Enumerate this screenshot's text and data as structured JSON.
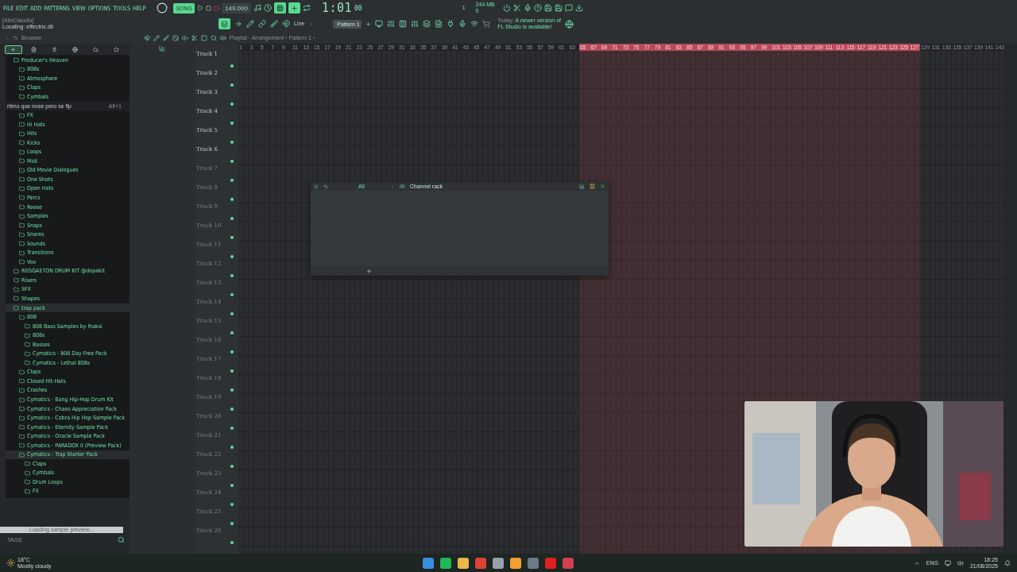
{
  "menu": [
    "FILE",
    "EDIT",
    "ADD",
    "PATTERNS",
    "VIEW",
    "OPTIONS",
    "TOOLS",
    "HELP"
  ],
  "transport": {
    "mode": "SONG",
    "tempo": "149.000",
    "time_main": "1:01",
    "time_sub": "00"
  },
  "monitor": {
    "voices": "1",
    "memory": "244 MB",
    "cpu": "0"
  },
  "hint": {
    "title": "[AlinClaudiu]",
    "text": "Locating: effectrix.dll"
  },
  "snap": "Line",
  "pattern": "Pattern 1",
  "news": {
    "date": "Today:",
    "line1": "A newer version of",
    "line2": "FL Studio is available!"
  },
  "browser": {
    "title": "Browser",
    "tabs": [
      {
        "selected": true
      },
      {
        "selected": false
      },
      {
        "selected": false
      },
      {
        "selected": false
      },
      {
        "selected": false
      },
      {
        "selected": false
      }
    ],
    "tree": [
      {
        "label": "Producer's Heaven",
        "selected": false,
        "children": [
          {
            "label": "808s",
            "selected": false
          },
          {
            "label": "Atmosphere",
            "selected": false
          },
          {
            "label": "Claps",
            "selected": false
          },
          {
            "label": "Cymbals",
            "selected": false
          },
          {
            "kind": "tooltip",
            "label": "ritmo que nose pero se flp",
            "shortcut": "Alt+1"
          },
          {
            "label": "FX",
            "selected": false
          },
          {
            "label": "Hi Hats",
            "selected": false
          },
          {
            "label": "Hits",
            "selected": false
          },
          {
            "label": "Kicks",
            "selected": false
          },
          {
            "label": "Loops",
            "selected": false
          },
          {
            "label": "Midi",
            "selected": false
          },
          {
            "label": "Old Movie Dialogues",
            "selected": false
          },
          {
            "label": "One Shots",
            "selected": false
          },
          {
            "label": "Open Hats",
            "selected": false
          },
          {
            "label": "Percs",
            "selected": false
          },
          {
            "label": "Reese",
            "selected": false
          },
          {
            "label": "Samples",
            "selected": false
          },
          {
            "label": "Snaps",
            "selected": false
          },
          {
            "label": "Snares",
            "selected": false
          },
          {
            "label": "Sounds",
            "selected": false
          },
          {
            "label": "Transitions",
            "selected": false
          },
          {
            "label": "Vox",
            "selected": false
          }
        ]
      },
      {
        "label": "REGGAETON DRUM KIT @dopekit",
        "selected": false
      },
      {
        "label": "Risers",
        "selected": false
      },
      {
        "label": "SFX",
        "selected": false
      },
      {
        "label": "Shapes",
        "selected": false
      },
      {
        "label": "trap pack",
        "selected": true,
        "children": [
          {
            "label": "808",
            "selected": false,
            "children": [
              {
                "label": "808 Bass Samples by Ihaksi",
                "selected": false
              },
              {
                "label": "808s",
                "selected": false
              },
              {
                "label": "Basses",
                "selected": false
              },
              {
                "label": "Cymatics - 808 Day Free Pack",
                "selected": false
              },
              {
                "label": "Cymatics - Lethal 808s",
                "selected": false
              }
            ]
          },
          {
            "label": "Claps",
            "selected": false
          },
          {
            "label": "Closed Hit-Hats",
            "selected": false
          },
          {
            "label": "Crashes",
            "selected": false
          },
          {
            "label": "Cymatics - Bang Hip-Hop Drum Kit",
            "selected": false
          },
          {
            "label": "Cymatics - Chaos Appreciation Pack",
            "selected": false
          },
          {
            "label": "Cymatics - Cobra Hip Hop Sample Pack",
            "selected": false
          },
          {
            "label": "Cymatics - Eternity Sample Pack",
            "selected": false
          },
          {
            "label": "Cymatics - Oracle Sample Pack",
            "selected": false
          },
          {
            "label": "Cymatics - PARADOX II (Preview Pack)",
            "selected": false
          },
          {
            "label": "Cymatics - Trap Starter Pack",
            "selected": true,
            "children": [
              {
                "label": "Claps",
                "selected": false
              },
              {
                "label": "Cymbals",
                "selected": false
              },
              {
                "label": "Drum Loops",
                "selected": false
              },
              {
                "label": "FX",
                "selected": false
              }
            ]
          }
        ]
      }
    ],
    "status": "Loading sample preview...",
    "tags": "TAGS"
  },
  "playlist": {
    "title": "Playlist - Arrangement › Pattern 1 ›",
    "ruler": [
      {
        "label": "1",
        "selected": false
      },
      {
        "label": "3",
        "selected": false
      },
      {
        "label": "5",
        "selected": false
      },
      {
        "label": "7",
        "selected": false
      },
      {
        "label": "9",
        "selected": false
      },
      {
        "label": "11",
        "selected": false
      },
      {
        "label": "13",
        "selected": false
      },
      {
        "label": "15",
        "selected": false
      },
      {
        "label": "17",
        "selected": false
      },
      {
        "label": "19",
        "selected": false
      },
      {
        "label": "21",
        "selected": false
      },
      {
        "label": "23",
        "selected": false
      },
      {
        "label": "25",
        "selected": false
      },
      {
        "label": "27",
        "selected": false
      },
      {
        "label": "29",
        "selected": false
      },
      {
        "label": "31",
        "selected": false
      },
      {
        "label": "33",
        "selected": false
      },
      {
        "label": "35",
        "selected": false
      },
      {
        "label": "37",
        "selected": false
      },
      {
        "label": "39",
        "selected": false
      },
      {
        "label": "41",
        "selected": false
      },
      {
        "label": "43",
        "selected": false
      },
      {
        "label": "45",
        "selected": false
      },
      {
        "label": "47",
        "selected": false
      },
      {
        "label": "49",
        "selected": false
      },
      {
        "label": "51",
        "selected": false
      },
      {
        "label": "53",
        "selected": false
      },
      {
        "label": "55",
        "selected": false
      },
      {
        "label": "57",
        "selected": false
      },
      {
        "label": "59",
        "selected": false
      },
      {
        "label": "61",
        "selected": false
      },
      {
        "label": "63",
        "selected": false
      },
      {
        "label": "65",
        "selected": true
      },
      {
        "label": "67",
        "selected": true
      },
      {
        "label": "69",
        "selected": true
      },
      {
        "label": "71",
        "selected": true
      },
      {
        "label": "73",
        "selected": true
      },
      {
        "label": "75",
        "selected": true
      },
      {
        "label": "77",
        "selected": true
      },
      {
        "label": "79",
        "selected": true
      },
      {
        "label": "81",
        "selected": true
      },
      {
        "label": "83",
        "selected": true
      },
      {
        "label": "85",
        "selected": true
      },
      {
        "label": "87",
        "selected": true
      },
      {
        "label": "89",
        "selected": true
      },
      {
        "label": "91",
        "selected": true
      },
      {
        "label": "93",
        "selected": true
      },
      {
        "label": "95",
        "selected": true
      },
      {
        "label": "97",
        "selected": true
      },
      {
        "label": "99",
        "selected": true
      },
      {
        "label": "101",
        "selected": true
      },
      {
        "label": "103",
        "selected": true
      },
      {
        "label": "105",
        "selected": true
      },
      {
        "label": "107",
        "selected": true
      },
      {
        "label": "109",
        "selected": true
      },
      {
        "label": "111",
        "selected": true
      },
      {
        "label": "113",
        "selected": true
      },
      {
        "label": "115",
        "selected": true
      },
      {
        "label": "117",
        "selected": true
      },
      {
        "label": "119",
        "selected": true
      },
      {
        "label": "121",
        "selected": true
      },
      {
        "label": "123",
        "selected": true
      },
      {
        "label": "125",
        "selected": true
      },
      {
        "label": "127",
        "selected": true
      },
      {
        "label": "129",
        "selected": false
      },
      {
        "label": "131",
        "selected": false
      },
      {
        "label": "133",
        "selected": false
      },
      {
        "label": "135",
        "selected": false
      },
      {
        "label": "137",
        "selected": false
      },
      {
        "label": "139",
        "selected": false
      },
      {
        "label": "141",
        "selected": false
      },
      {
        "label": "143",
        "selected": false
      }
    ],
    "tracks": [
      {
        "name": "Track 1",
        "dimmed": false
      },
      {
        "name": "Track 2",
        "dimmed": false
      },
      {
        "name": "Track 3",
        "dimmed": false
      },
      {
        "name": "Track 4",
        "dimmed": false
      },
      {
        "name": "Track 5",
        "dimmed": false
      },
      {
        "name": "Track 6",
        "dimmed": false
      },
      {
        "name": "Track 7",
        "dimmed": true
      },
      {
        "name": "Track 8",
        "dimmed": true
      },
      {
        "name": "Track 9",
        "dimmed": true
      },
      {
        "name": "Track 10",
        "dimmed": true
      },
      {
        "name": "Track 11",
        "dimmed": true
      },
      {
        "name": "Track 12",
        "dimmed": true
      },
      {
        "name": "Track 13",
        "dimmed": true
      },
      {
        "name": "Track 14",
        "dimmed": true
      },
      {
        "name": "Track 15",
        "dimmed": true
      },
      {
        "name": "Track 16",
        "dimmed": true
      },
      {
        "name": "Track 17",
        "dimmed": true
      },
      {
        "name": "Track 18",
        "dimmed": true
      },
      {
        "name": "Track 19",
        "dimmed": true
      },
      {
        "name": "Track 20",
        "dimmed": true
      },
      {
        "name": "Track 21",
        "dimmed": true
      },
      {
        "name": "Track 22",
        "dimmed": true
      },
      {
        "name": "Track 23",
        "dimmed": true
      },
      {
        "name": "Track 24",
        "dimmed": true
      },
      {
        "name": "Track 25",
        "dimmed": true
      },
      {
        "name": "Track 26",
        "dimmed": true
      }
    ]
  },
  "channel_rack": {
    "filter": "All",
    "title": "Channel rack"
  },
  "taskbar": {
    "weather": {
      "temp": "18°C",
      "text": "Mostly cloudy"
    },
    "lang": "ENG",
    "time": "18:25",
    "date": "21/08/2025"
  }
}
